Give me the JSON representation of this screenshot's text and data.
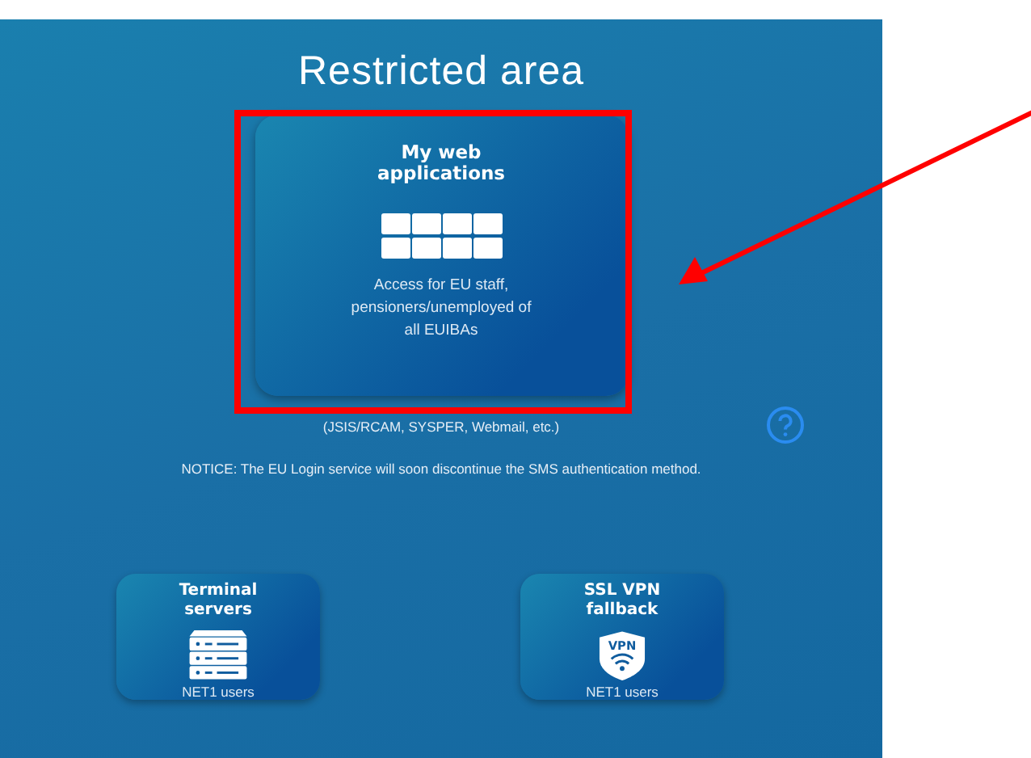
{
  "title": "Restricted area",
  "main_card": {
    "title": "My web applications",
    "description": "Access for EU staff, pensioners/unemployed of all EUIBAs",
    "highlighted": true
  },
  "caption": "(JSIS/RCAM, SYSPER, Webmail, etc.)",
  "notice": "NOTICE: The EU Login service will soon discontinue the SMS authentication method.",
  "tiles": [
    {
      "kind": "server",
      "title": "Terminal servers",
      "subtitle": "NET1 users"
    },
    {
      "kind": "vpn",
      "title": "SSL VPN fallback",
      "icon_text": "VPN",
      "subtitle": "NET1 users"
    }
  ]
}
